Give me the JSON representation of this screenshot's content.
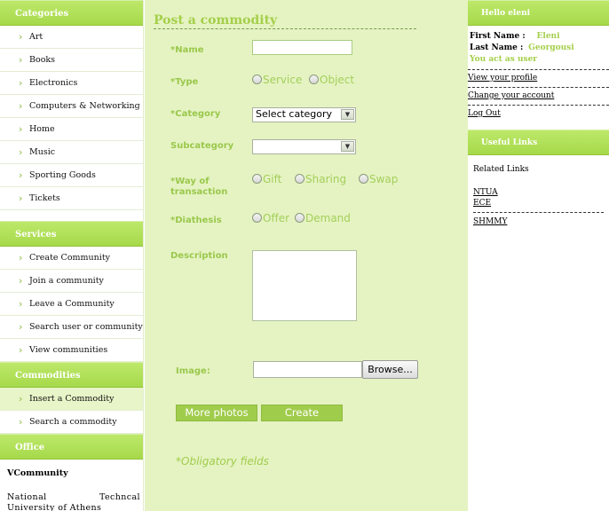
{
  "left": {
    "categories": {
      "title": "Categories",
      "items": [
        "Art",
        "Books",
        "Electronics",
        "Computers & Networking",
        "Home",
        "Music",
        "Sporting Goods",
        "Tickets"
      ]
    },
    "services": {
      "title": "Services",
      "items": [
        "Create Community",
        "Join a community",
        "Leave a Community",
        "Search user or community",
        "View communities"
      ]
    },
    "commodities": {
      "title": "Commodities",
      "items": [
        "Insert a Commodity",
        "Search a commodity"
      ]
    },
    "office": {
      "title": "Office",
      "name": "VCommunity",
      "address": "National Techncal University of Athens"
    }
  },
  "form": {
    "title": "Post a commodity",
    "name_label": "*Name",
    "name_value": "",
    "type_label": "*Type",
    "type_options": [
      "Service",
      "Object"
    ],
    "category_label": "*Category",
    "category_selected": "Select category",
    "subcategory_label": "Subcategory",
    "subcategory_selected": "",
    "way_label_1": "*Way of",
    "way_label_2": "transaction",
    "way_options": [
      "Gift",
      "Sharing",
      "Swap"
    ],
    "diathesis_label": "*Diathesis",
    "diathesis_options": [
      "Offer",
      "Demand"
    ],
    "description_label": "Description",
    "description_value": "",
    "image_label": "Image:",
    "browse_label": "Browse...",
    "more_photos_label": "More photos",
    "create_label": "Create",
    "obligatory_note": "*Obligatory fields"
  },
  "right": {
    "greeting": "Hello eleni",
    "first_name_label": "First Name :",
    "first_name": "Eleni",
    "last_name_label": "Last Name :",
    "last_name": "Georgousi",
    "role_note": "You act as user",
    "links": [
      "View your profile",
      "Change your account",
      "Log Out"
    ],
    "useful_title": "Useful Links",
    "related_title": "Related Links",
    "related_links": [
      "NTUA",
      "ECE",
      "SHMMY"
    ]
  },
  "colors": {
    "accent_green": "#a6d94a",
    "label_green": "#9ac84c",
    "main_bg": "#e5f3c2"
  }
}
